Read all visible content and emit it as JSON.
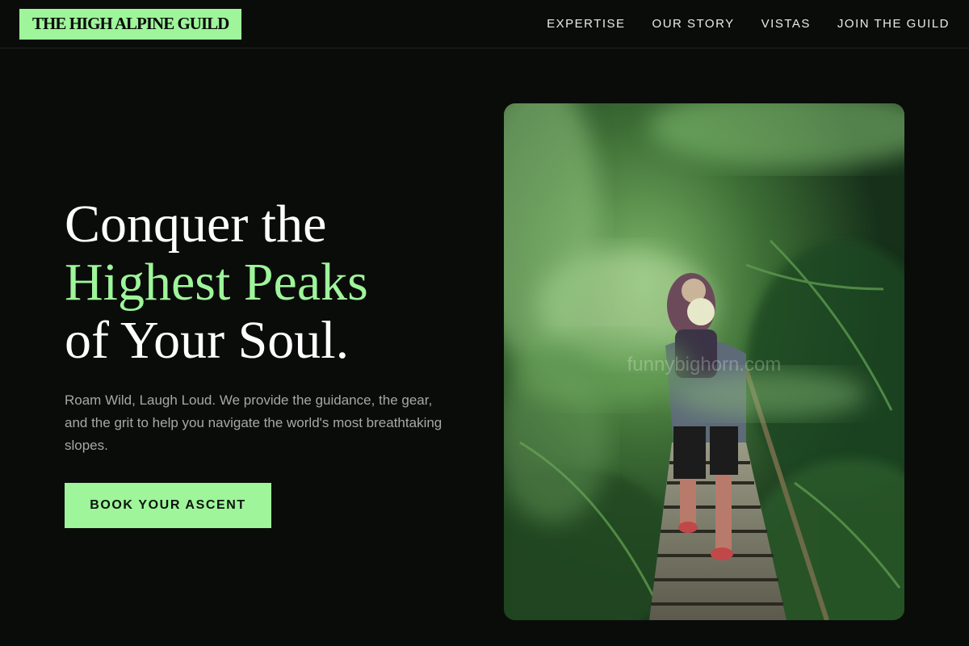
{
  "header": {
    "logo": "THE HIGH ALPINE GUILD",
    "nav": [
      {
        "label": "EXPERTISE"
      },
      {
        "label": "OUR STORY"
      },
      {
        "label": "VISTAS"
      },
      {
        "label": "JOIN THE GUILD"
      }
    ]
  },
  "hero": {
    "headline_line1": "Conquer the",
    "headline_accent": "Highest Peaks",
    "headline_line3": "of Your Soul.",
    "subtitle": "Roam Wild, Laugh Loud. We provide the guidance, the gear, and the grit to help you navigate the world's most breathtaking slopes.",
    "cta_label": "BOOK YOUR ASCENT",
    "image_watermark": "funnybighorn.com"
  },
  "colors": {
    "background": "#0a0c0a",
    "accent": "#9ef59a",
    "text": "#ffffff",
    "muted_text": "#a3aaa3"
  }
}
